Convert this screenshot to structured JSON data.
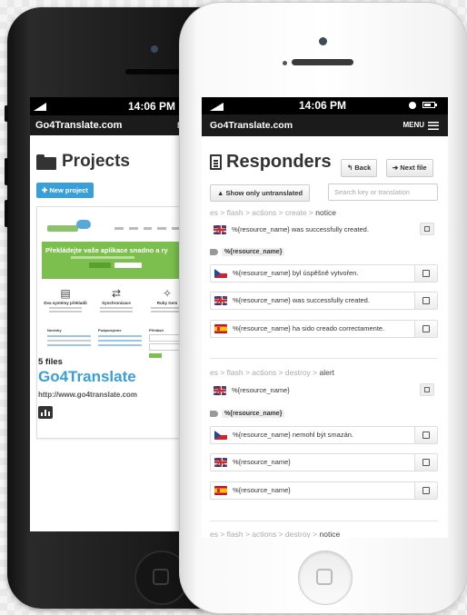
{
  "left_phone": {
    "status_time": "14:06 PM",
    "brand": "Go4Translate.com",
    "menu_cut": "M",
    "page_title": "Projects",
    "new_project_label": "New project",
    "project": {
      "files_count": "5 files",
      "name": "Go4Translate",
      "url": "http://www.go4translate.com",
      "thumbnail_headline": "Překládejte vaše aplikace snadno a ry",
      "thumbnail_features": [
        "Dva systémy překladů",
        "Synchronizace",
        "Ruby Gem"
      ],
      "thumbnail_columns": [
        "Novinky",
        "Podporujeme",
        "Přihlásit"
      ]
    }
  },
  "right_phone": {
    "status_time": "14:06 PM",
    "brand": "Go4Translate.com",
    "menu_label": "MENU",
    "page_title": "Responders",
    "back_label": "Back",
    "next_file_label": "Next file",
    "toggle_label": "Show only untranslated",
    "search_placeholder": "Search key or translation",
    "groups": [
      {
        "breadcrumb_path": "es > flash > actions > create >",
        "breadcrumb_key": "notice",
        "source": {
          "flag": "uk",
          "text": "%{resource_name} was successfully created."
        },
        "tag": "%{resource_name}",
        "translations": [
          {
            "flag": "cz",
            "text": "%{resource_name} byl úspěšně vytvořen."
          },
          {
            "flag": "uk",
            "text": "%{resource_name} was successfully created."
          },
          {
            "flag": "es",
            "text": "%{resource_name} ha sido creado correctamente."
          }
        ]
      },
      {
        "breadcrumb_path": "es > flash > actions > destroy >",
        "breadcrumb_key": "alert",
        "source": {
          "flag": "uk",
          "text": "%{resource_name}"
        },
        "tag": "%{resource_name}",
        "translations": [
          {
            "flag": "cz",
            "text": "%{resource_name} nemohl být smazán."
          },
          {
            "flag": "uk",
            "text": "%{resource_name}"
          },
          {
            "flag": "es",
            "text": "%{resource_name}"
          }
        ]
      },
      {
        "breadcrumb_path": "es > flash > actions > destroy >",
        "breadcrumb_key": "notice"
      }
    ]
  },
  "colors": {
    "accent_blue": "#3a9fd8",
    "hero_green": "#7cbf4f",
    "navbar": "#1b1b1b"
  },
  "icons": [
    "folder-icon",
    "document-icon",
    "back-arrow-icon",
    "forward-arrow-icon",
    "hamburger-icon",
    "tag-icon",
    "edit-icon",
    "copy-icon",
    "bar-chart-icon"
  ]
}
